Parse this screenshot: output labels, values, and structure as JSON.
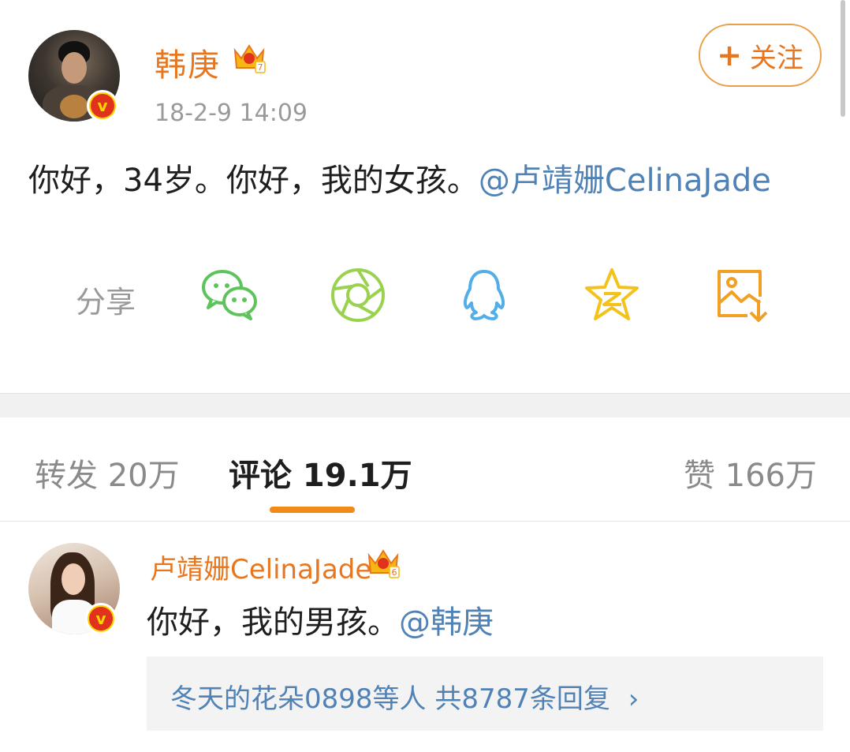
{
  "post": {
    "author": "韩庚",
    "time": "18-2-9 14:09",
    "follow_label": "关注",
    "text": "你好，34岁。你好，我的女孩。",
    "mention": "@卢靖姗CelinaJade"
  },
  "share": {
    "label": "分享",
    "icons": [
      "wechat-icon",
      "moments-icon",
      "qq-icon",
      "qzone-icon",
      "save-image-icon"
    ]
  },
  "tabs": {
    "repost": "转发 20万",
    "comments": "评论 19.1万",
    "likes": "赞 166万"
  },
  "comment": {
    "author": "卢靖姗CelinaJade",
    "text": "你好，我的男孩。",
    "mention": "@韩庚",
    "replies": "冬天的花朵0898等人  共8787条回复",
    "chevron": "›"
  },
  "colors": {
    "name_orange": "#e8761e",
    "link_blue": "#5182b5",
    "tab_underline": "#f08a19",
    "wechat": "#5dc35b",
    "moments": "#9ad14f",
    "qq": "#52aee8",
    "qzone": "#f3c21b",
    "save": "#f0a024"
  },
  "vip_levels": {
    "author": "7",
    "commenter": "6"
  }
}
